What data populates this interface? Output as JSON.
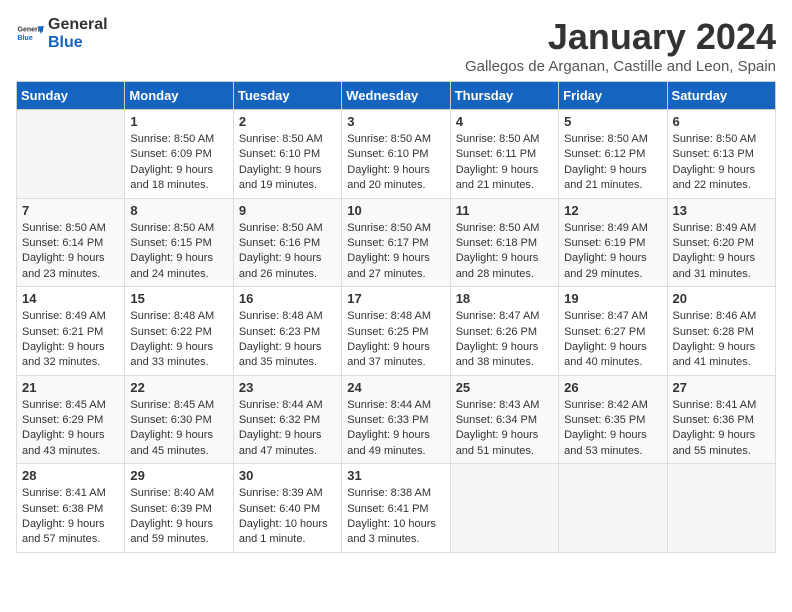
{
  "header": {
    "logo_general": "General",
    "logo_blue": "Blue",
    "month": "January 2024",
    "location": "Gallegos de Arganan, Castille and Leon, Spain"
  },
  "days_of_week": [
    "Sunday",
    "Monday",
    "Tuesday",
    "Wednesday",
    "Thursday",
    "Friday",
    "Saturday"
  ],
  "weeks": [
    [
      {
        "day": "",
        "sunrise": "",
        "sunset": "",
        "daylight": ""
      },
      {
        "day": "1",
        "sunrise": "Sunrise: 8:50 AM",
        "sunset": "Sunset: 6:09 PM",
        "daylight": "Daylight: 9 hours and 18 minutes."
      },
      {
        "day": "2",
        "sunrise": "Sunrise: 8:50 AM",
        "sunset": "Sunset: 6:10 PM",
        "daylight": "Daylight: 9 hours and 19 minutes."
      },
      {
        "day": "3",
        "sunrise": "Sunrise: 8:50 AM",
        "sunset": "Sunset: 6:10 PM",
        "daylight": "Daylight: 9 hours and 20 minutes."
      },
      {
        "day": "4",
        "sunrise": "Sunrise: 8:50 AM",
        "sunset": "Sunset: 6:11 PM",
        "daylight": "Daylight: 9 hours and 21 minutes."
      },
      {
        "day": "5",
        "sunrise": "Sunrise: 8:50 AM",
        "sunset": "Sunset: 6:12 PM",
        "daylight": "Daylight: 9 hours and 21 minutes."
      },
      {
        "day": "6",
        "sunrise": "Sunrise: 8:50 AM",
        "sunset": "Sunset: 6:13 PM",
        "daylight": "Daylight: 9 hours and 22 minutes."
      }
    ],
    [
      {
        "day": "7",
        "sunrise": "Sunrise: 8:50 AM",
        "sunset": "Sunset: 6:14 PM",
        "daylight": "Daylight: 9 hours and 23 minutes."
      },
      {
        "day": "8",
        "sunrise": "Sunrise: 8:50 AM",
        "sunset": "Sunset: 6:15 PM",
        "daylight": "Daylight: 9 hours and 24 minutes."
      },
      {
        "day": "9",
        "sunrise": "Sunrise: 8:50 AM",
        "sunset": "Sunset: 6:16 PM",
        "daylight": "Daylight: 9 hours and 26 minutes."
      },
      {
        "day": "10",
        "sunrise": "Sunrise: 8:50 AM",
        "sunset": "Sunset: 6:17 PM",
        "daylight": "Daylight: 9 hours and 27 minutes."
      },
      {
        "day": "11",
        "sunrise": "Sunrise: 8:50 AM",
        "sunset": "Sunset: 6:18 PM",
        "daylight": "Daylight: 9 hours and 28 minutes."
      },
      {
        "day": "12",
        "sunrise": "Sunrise: 8:49 AM",
        "sunset": "Sunset: 6:19 PM",
        "daylight": "Daylight: 9 hours and 29 minutes."
      },
      {
        "day": "13",
        "sunrise": "Sunrise: 8:49 AM",
        "sunset": "Sunset: 6:20 PM",
        "daylight": "Daylight: 9 hours and 31 minutes."
      }
    ],
    [
      {
        "day": "14",
        "sunrise": "Sunrise: 8:49 AM",
        "sunset": "Sunset: 6:21 PM",
        "daylight": "Daylight: 9 hours and 32 minutes."
      },
      {
        "day": "15",
        "sunrise": "Sunrise: 8:48 AM",
        "sunset": "Sunset: 6:22 PM",
        "daylight": "Daylight: 9 hours and 33 minutes."
      },
      {
        "day": "16",
        "sunrise": "Sunrise: 8:48 AM",
        "sunset": "Sunset: 6:23 PM",
        "daylight": "Daylight: 9 hours and 35 minutes."
      },
      {
        "day": "17",
        "sunrise": "Sunrise: 8:48 AM",
        "sunset": "Sunset: 6:25 PM",
        "daylight": "Daylight: 9 hours and 37 minutes."
      },
      {
        "day": "18",
        "sunrise": "Sunrise: 8:47 AM",
        "sunset": "Sunset: 6:26 PM",
        "daylight": "Daylight: 9 hours and 38 minutes."
      },
      {
        "day": "19",
        "sunrise": "Sunrise: 8:47 AM",
        "sunset": "Sunset: 6:27 PM",
        "daylight": "Daylight: 9 hours and 40 minutes."
      },
      {
        "day": "20",
        "sunrise": "Sunrise: 8:46 AM",
        "sunset": "Sunset: 6:28 PM",
        "daylight": "Daylight: 9 hours and 41 minutes."
      }
    ],
    [
      {
        "day": "21",
        "sunrise": "Sunrise: 8:45 AM",
        "sunset": "Sunset: 6:29 PM",
        "daylight": "Daylight: 9 hours and 43 minutes."
      },
      {
        "day": "22",
        "sunrise": "Sunrise: 8:45 AM",
        "sunset": "Sunset: 6:30 PM",
        "daylight": "Daylight: 9 hours and 45 minutes."
      },
      {
        "day": "23",
        "sunrise": "Sunrise: 8:44 AM",
        "sunset": "Sunset: 6:32 PM",
        "daylight": "Daylight: 9 hours and 47 minutes."
      },
      {
        "day": "24",
        "sunrise": "Sunrise: 8:44 AM",
        "sunset": "Sunset: 6:33 PM",
        "daylight": "Daylight: 9 hours and 49 minutes."
      },
      {
        "day": "25",
        "sunrise": "Sunrise: 8:43 AM",
        "sunset": "Sunset: 6:34 PM",
        "daylight": "Daylight: 9 hours and 51 minutes."
      },
      {
        "day": "26",
        "sunrise": "Sunrise: 8:42 AM",
        "sunset": "Sunset: 6:35 PM",
        "daylight": "Daylight: 9 hours and 53 minutes."
      },
      {
        "day": "27",
        "sunrise": "Sunrise: 8:41 AM",
        "sunset": "Sunset: 6:36 PM",
        "daylight": "Daylight: 9 hours and 55 minutes."
      }
    ],
    [
      {
        "day": "28",
        "sunrise": "Sunrise: 8:41 AM",
        "sunset": "Sunset: 6:38 PM",
        "daylight": "Daylight: 9 hours and 57 minutes."
      },
      {
        "day": "29",
        "sunrise": "Sunrise: 8:40 AM",
        "sunset": "Sunset: 6:39 PM",
        "daylight": "Daylight: 9 hours and 59 minutes."
      },
      {
        "day": "30",
        "sunrise": "Sunrise: 8:39 AM",
        "sunset": "Sunset: 6:40 PM",
        "daylight": "Daylight: 10 hours and 1 minute."
      },
      {
        "day": "31",
        "sunrise": "Sunrise: 8:38 AM",
        "sunset": "Sunset: 6:41 PM",
        "daylight": "Daylight: 10 hours and 3 minutes."
      },
      {
        "day": "",
        "sunrise": "",
        "sunset": "",
        "daylight": ""
      },
      {
        "day": "",
        "sunrise": "",
        "sunset": "",
        "daylight": ""
      },
      {
        "day": "",
        "sunrise": "",
        "sunset": "",
        "daylight": ""
      }
    ]
  ]
}
